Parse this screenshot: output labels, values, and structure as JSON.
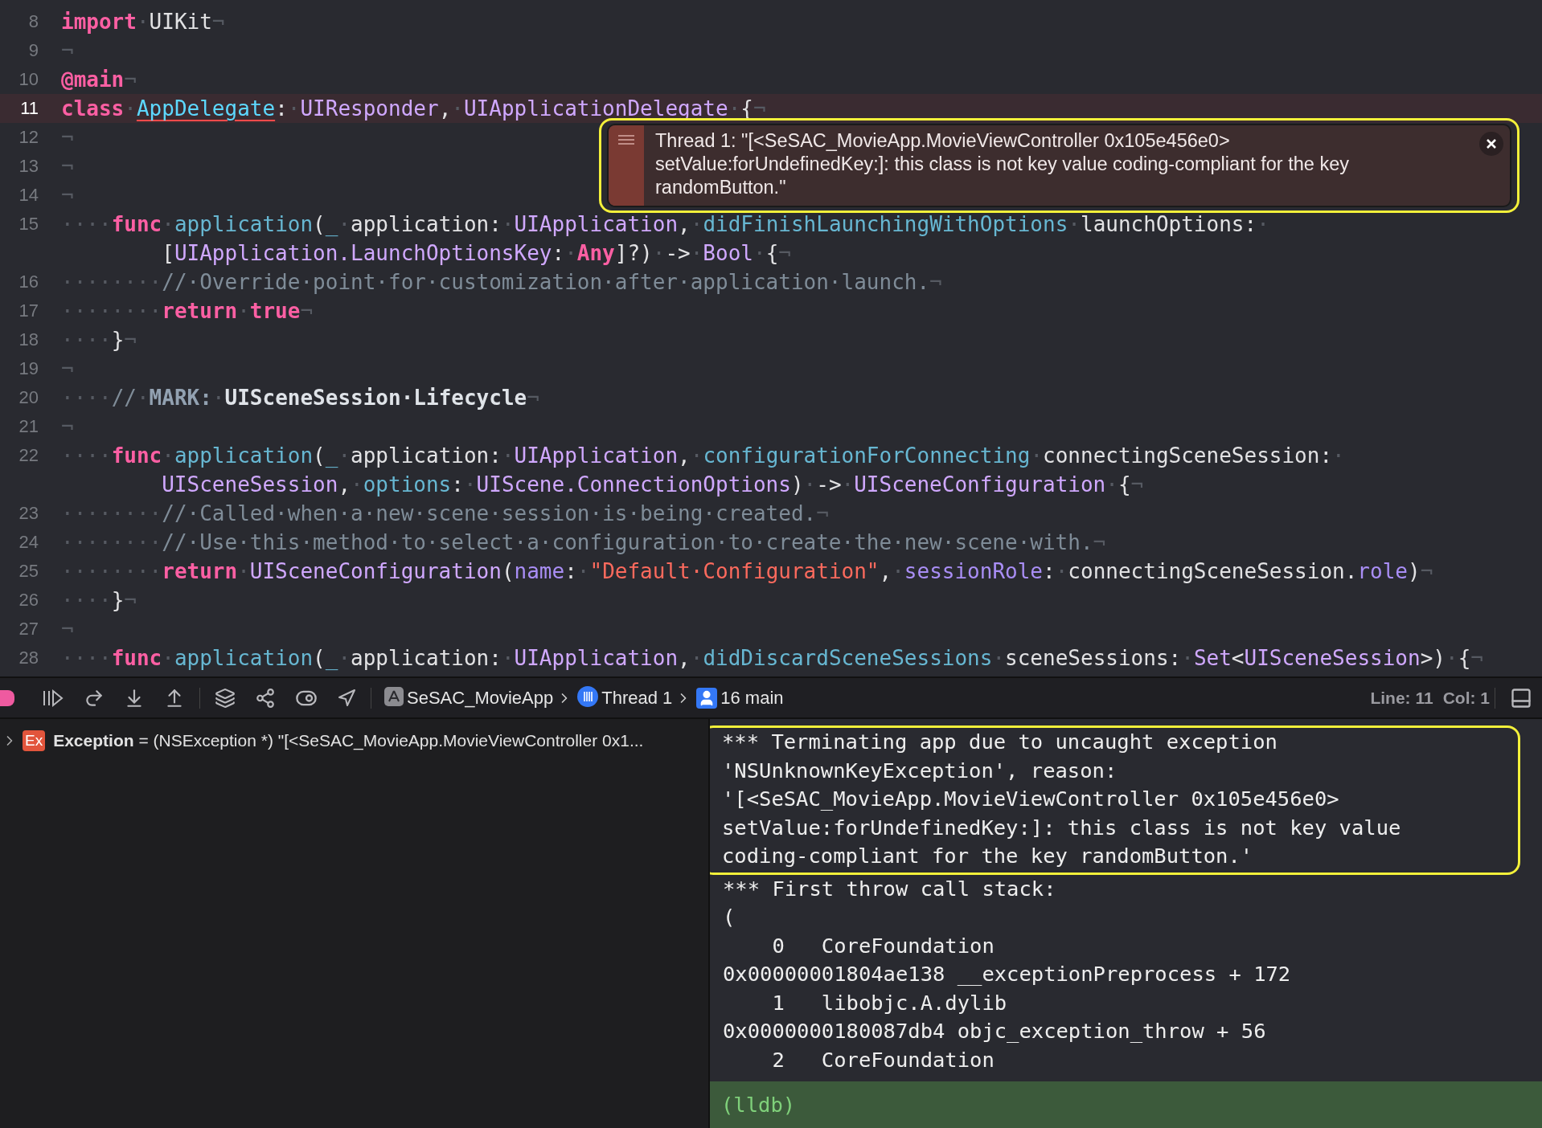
{
  "editor": {
    "lines": [
      {
        "number": "8",
        "current": false,
        "rows": [
          {
            "tokens": [
              {
                "kind": "kw",
                "text": "import"
              },
              {
                "kind": "ws",
                "text": "·"
              },
              {
                "kind": "plain",
                "text": "UIKit"
              },
              {
                "kind": "ws",
                "text": "¬"
              }
            ]
          }
        ]
      },
      {
        "number": "9",
        "current": false,
        "rows": [
          {
            "tokens": [
              {
                "kind": "ws",
                "text": "¬"
              }
            ]
          }
        ]
      },
      {
        "number": "10",
        "current": false,
        "rows": [
          {
            "tokens": [
              {
                "kind": "kw",
                "text": "@main"
              },
              {
                "kind": "ws",
                "text": "¬"
              }
            ]
          }
        ]
      },
      {
        "number": "11",
        "current": true,
        "rows": [
          {
            "tokens": [
              {
                "kind": "kw",
                "text": "class"
              },
              {
                "kind": "ws",
                "text": "·"
              },
              {
                "kind": "decl",
                "text": "AppDelegate"
              },
              {
                "kind": "plain",
                "text": ":"
              },
              {
                "kind": "ws",
                "text": "·"
              },
              {
                "kind": "type",
                "text": "UIResponder"
              },
              {
                "kind": "plain",
                "text": ","
              },
              {
                "kind": "ws",
                "text": "·"
              },
              {
                "kind": "type",
                "text": "UIApplicationDelegate"
              },
              {
                "kind": "ws",
                "text": "·"
              },
              {
                "kind": "plain",
                "text": "{"
              },
              {
                "kind": "ws",
                "text": "¬"
              }
            ]
          }
        ]
      },
      {
        "number": "12",
        "current": false,
        "rows": [
          {
            "tokens": [
              {
                "kind": "ws",
                "text": "¬"
              }
            ]
          }
        ]
      },
      {
        "number": "13",
        "current": false,
        "rows": [
          {
            "tokens": [
              {
                "kind": "ws",
                "text": "¬"
              }
            ]
          }
        ]
      },
      {
        "number": "14",
        "current": false,
        "rows": [
          {
            "tokens": [
              {
                "kind": "ws",
                "text": "¬"
              }
            ]
          }
        ]
      },
      {
        "number": "15",
        "current": false,
        "rows": [
          {
            "tokens": [
              {
                "kind": "ws",
                "text": "····"
              },
              {
                "kind": "kw",
                "text": "func"
              },
              {
                "kind": "ws",
                "text": "·"
              },
              {
                "kind": "fn",
                "text": "application"
              },
              {
                "kind": "plain",
                "text": "("
              },
              {
                "kind": "fn",
                "text": "_"
              },
              {
                "kind": "ws",
                "text": "·"
              },
              {
                "kind": "plain",
                "text": "application:"
              },
              {
                "kind": "ws",
                "text": "·"
              },
              {
                "kind": "type",
                "text": "UIApplication"
              },
              {
                "kind": "plain",
                "text": ","
              },
              {
                "kind": "ws",
                "text": "·"
              },
              {
                "kind": "fn",
                "text": "didFinishLaunchingWithOptions"
              },
              {
                "kind": "ws",
                "text": "·"
              },
              {
                "kind": "plain",
                "text": "launchOptions:"
              },
              {
                "kind": "ws",
                "text": "·"
              }
            ]
          },
          {
            "tokens": [
              {
                "kind": "plain",
                "text": "["
              },
              {
                "kind": "type",
                "text": "UIApplication.LaunchOptionsKey"
              },
              {
                "kind": "plain",
                "text": ":"
              },
              {
                "kind": "ws",
                "text": "·"
              },
              {
                "kind": "kw",
                "text": "Any"
              },
              {
                "kind": "plain",
                "text": "]?)"
              },
              {
                "kind": "ws",
                "text": "·"
              },
              {
                "kind": "plain",
                "text": "->"
              },
              {
                "kind": "ws",
                "text": "·"
              },
              {
                "kind": "type",
                "text": "Bool"
              },
              {
                "kind": "ws",
                "text": "·"
              },
              {
                "kind": "plain",
                "text": "{"
              },
              {
                "kind": "ws",
                "text": "¬"
              }
            ]
          }
        ]
      },
      {
        "number": "16",
        "current": false,
        "rows": [
          {
            "tokens": [
              {
                "kind": "ws",
                "text": "········"
              },
              {
                "kind": "comment",
                "text": "//·Override·point·for·customization·after·application·launch."
              },
              {
                "kind": "ws",
                "text": "¬"
              }
            ]
          }
        ]
      },
      {
        "number": "17",
        "current": false,
        "rows": [
          {
            "tokens": [
              {
                "kind": "ws",
                "text": "········"
              },
              {
                "kind": "kw",
                "text": "return"
              },
              {
                "kind": "ws",
                "text": "·"
              },
              {
                "kind": "kw",
                "text": "true"
              },
              {
                "kind": "ws",
                "text": "¬"
              }
            ]
          }
        ]
      },
      {
        "number": "18",
        "current": false,
        "rows": [
          {
            "tokens": [
              {
                "kind": "ws",
                "text": "····"
              },
              {
                "kind": "plain",
                "text": "}"
              },
              {
                "kind": "ws",
                "text": "¬"
              }
            ]
          }
        ]
      },
      {
        "number": "19",
        "current": false,
        "rows": [
          {
            "tokens": [
              {
                "kind": "ws",
                "text": "¬"
              }
            ]
          }
        ]
      },
      {
        "number": "20",
        "current": false,
        "rows": [
          {
            "tokens": [
              {
                "kind": "ws",
                "text": "····"
              },
              {
                "kind": "comment",
                "text": "//"
              },
              {
                "kind": "ws",
                "text": "·"
              },
              {
                "kind": "mark",
                "text": "MARK:"
              },
              {
                "kind": "ws",
                "text": "·"
              },
              {
                "kind": "markt",
                "text": "UISceneSession·Lifecycle"
              },
              {
                "kind": "ws",
                "text": "¬"
              }
            ]
          }
        ]
      },
      {
        "number": "21",
        "current": false,
        "rows": [
          {
            "tokens": [
              {
                "kind": "ws",
                "text": "¬"
              }
            ]
          }
        ]
      },
      {
        "number": "22",
        "current": false,
        "rows": [
          {
            "tokens": [
              {
                "kind": "ws",
                "text": "····"
              },
              {
                "kind": "kw",
                "text": "func"
              },
              {
                "kind": "ws",
                "text": "·"
              },
              {
                "kind": "fn",
                "text": "application"
              },
              {
                "kind": "plain",
                "text": "("
              },
              {
                "kind": "fn",
                "text": "_"
              },
              {
                "kind": "ws",
                "text": "·"
              },
              {
                "kind": "plain",
                "text": "application:"
              },
              {
                "kind": "ws",
                "text": "·"
              },
              {
                "kind": "type",
                "text": "UIApplication"
              },
              {
                "kind": "plain",
                "text": ","
              },
              {
                "kind": "ws",
                "text": "·"
              },
              {
                "kind": "fn",
                "text": "configurationForConnecting"
              },
              {
                "kind": "ws",
                "text": "·"
              },
              {
                "kind": "plain",
                "text": "connectingSceneSession:"
              },
              {
                "kind": "ws",
                "text": "·"
              }
            ]
          },
          {
            "tokens": [
              {
                "kind": "type",
                "text": "UISceneSession"
              },
              {
                "kind": "plain",
                "text": ","
              },
              {
                "kind": "ws",
                "text": "·"
              },
              {
                "kind": "fn",
                "text": "options"
              },
              {
                "kind": "plain",
                "text": ":"
              },
              {
                "kind": "ws",
                "text": "·"
              },
              {
                "kind": "type",
                "text": "UIScene.ConnectionOptions"
              },
              {
                "kind": "plain",
                "text": ")"
              },
              {
                "kind": "ws",
                "text": "·"
              },
              {
                "kind": "plain",
                "text": "->"
              },
              {
                "kind": "ws",
                "text": "·"
              },
              {
                "kind": "type",
                "text": "UISceneConfiguration"
              },
              {
                "kind": "ws",
                "text": "·"
              },
              {
                "kind": "plain",
                "text": "{"
              },
              {
                "kind": "ws",
                "text": "¬"
              }
            ]
          }
        ]
      },
      {
        "number": "23",
        "current": false,
        "rows": [
          {
            "tokens": [
              {
                "kind": "ws",
                "text": "········"
              },
              {
                "kind": "comment",
                "text": "//·Called·when·a·new·scene·session·is·being·created."
              },
              {
                "kind": "ws",
                "text": "¬"
              }
            ]
          }
        ]
      },
      {
        "number": "24",
        "current": false,
        "rows": [
          {
            "tokens": [
              {
                "kind": "ws",
                "text": "········"
              },
              {
                "kind": "comment",
                "text": "//·Use·this·method·to·select·a·configuration·to·create·the·new·scene·with."
              },
              {
                "kind": "ws",
                "text": "¬"
              }
            ]
          }
        ]
      },
      {
        "number": "25",
        "current": false,
        "rows": [
          {
            "tokens": [
              {
                "kind": "ws",
                "text": "········"
              },
              {
                "kind": "kw",
                "text": "return"
              },
              {
                "kind": "ws",
                "text": "·"
              },
              {
                "kind": "type",
                "text": "UISceneConfiguration"
              },
              {
                "kind": "plain",
                "text": "("
              },
              {
                "kind": "prop",
                "text": "name"
              },
              {
                "kind": "plain",
                "text": ":"
              },
              {
                "kind": "ws",
                "text": "·"
              },
              {
                "kind": "str",
                "text": "\"Default·Configuration\""
              },
              {
                "kind": "plain",
                "text": ","
              },
              {
                "kind": "ws",
                "text": "·"
              },
              {
                "kind": "prop",
                "text": "sessionRole"
              },
              {
                "kind": "plain",
                "text": ":"
              },
              {
                "kind": "ws",
                "text": "·"
              },
              {
                "kind": "plain",
                "text": "connectingSceneSession."
              },
              {
                "kind": "prop",
                "text": "role"
              },
              {
                "kind": "plain",
                "text": ")"
              },
              {
                "kind": "ws",
                "text": "¬"
              }
            ]
          }
        ]
      },
      {
        "number": "26",
        "current": false,
        "rows": [
          {
            "tokens": [
              {
                "kind": "ws",
                "text": "····"
              },
              {
                "kind": "plain",
                "text": "}"
              },
              {
                "kind": "ws",
                "text": "¬"
              }
            ]
          }
        ]
      },
      {
        "number": "27",
        "current": false,
        "rows": [
          {
            "tokens": [
              {
                "kind": "ws",
                "text": "¬"
              }
            ]
          }
        ]
      },
      {
        "number": "28",
        "current": false,
        "rows": [
          {
            "tokens": [
              {
                "kind": "ws",
                "text": "····"
              },
              {
                "kind": "kw",
                "text": "func"
              },
              {
                "kind": "ws",
                "text": "·"
              },
              {
                "kind": "fn",
                "text": "application"
              },
              {
                "kind": "plain",
                "text": "("
              },
              {
                "kind": "fn",
                "text": "_"
              },
              {
                "kind": "ws",
                "text": "·"
              },
              {
                "kind": "plain",
                "text": "application:"
              },
              {
                "kind": "ws",
                "text": "·"
              },
              {
                "kind": "type",
                "text": "UIApplication"
              },
              {
                "kind": "plain",
                "text": ","
              },
              {
                "kind": "ws",
                "text": "·"
              },
              {
                "kind": "fn",
                "text": "didDiscardSceneSessions"
              },
              {
                "kind": "ws",
                "text": "·"
              },
              {
                "kind": "plain",
                "text": "sceneSessions:"
              },
              {
                "kind": "ws",
                "text": "·"
              },
              {
                "kind": "type",
                "text": "Set"
              },
              {
                "kind": "plain",
                "text": "<"
              },
              {
                "kind": "type",
                "text": "UISceneSession"
              },
              {
                "kind": "plain",
                "text": ">)"
              },
              {
                "kind": "ws",
                "text": "·"
              },
              {
                "kind": "plain",
                "text": "{"
              },
              {
                "kind": "ws",
                "text": "¬"
              }
            ]
          }
        ]
      }
    ],
    "error_popup": {
      "message": "Thread 1: \"[<SeSAC_MovieApp.MovieViewController 0x105e456e0> setValue:forUndefinedKey:]: this class is not key value coding-compliant for the key randomButton.\""
    }
  },
  "debug_bar": {
    "breadcrumbs": [
      "SeSAC_MovieApp",
      "Thread 1",
      "16 main"
    ],
    "line": "Line: 11",
    "column": "Col: 1"
  },
  "variables": [
    {
      "expanded": false,
      "badge": "Ex",
      "text": "**Exception** = (NSException *) \"[<SeSAC_MovieApp.MovieViewController 0x1..."
    }
  ],
  "console": {
    "highlighted_lines": [
      "*** Terminating app due to uncaught exception",
      "'NSUnknownKeyException', reason:",
      "'[<SeSAC_MovieApp.MovieViewController 0x105e456e0>",
      "setValue:forUndefinedKey:]: this class is not key value",
      "coding-compliant for the key randomButton.'"
    ],
    "lines": [
      "*** First throw call stack:",
      "(",
      "    0   CoreFoundation",
      "0x00000001804ae138 __exceptionPreprocess + 172",
      "    1   libobjc.A.dylib",
      "0x0000000180087db4 objc_exception_throw + 56",
      "    2   CoreFoundation"
    ],
    "prompt": "(lldb)"
  }
}
